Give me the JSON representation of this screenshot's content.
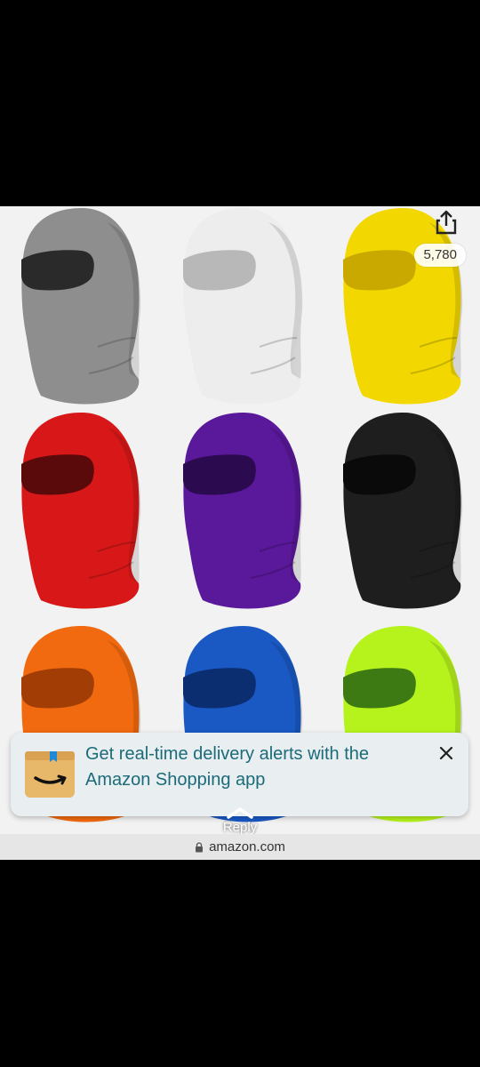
{
  "product_image": {
    "masks": [
      {
        "color_name": "gray",
        "fill": "#8e8e8e",
        "eye": "#2a2a2a"
      },
      {
        "color_name": "white",
        "fill": "#ededed",
        "eye": "#b8b8b8"
      },
      {
        "color_name": "yellow",
        "fill": "#f2d800",
        "eye": "#c9a800"
      },
      {
        "color_name": "red",
        "fill": "#d81818",
        "eye": "#5a0a0a"
      },
      {
        "color_name": "purple",
        "fill": "#5a189a",
        "eye": "#2c0a4f"
      },
      {
        "color_name": "black",
        "fill": "#1e1e1e",
        "eye": "#0a0a0a"
      },
      {
        "color_name": "orange",
        "fill": "#f26a0f",
        "eye": "#a33d06"
      },
      {
        "color_name": "blue",
        "fill": "#1a59c4",
        "eye": "#0b2e70"
      },
      {
        "color_name": "lime",
        "fill": "#b6f21c",
        "eye": "#3e7a14"
      }
    ]
  },
  "overlay": {
    "share_icon": "share-icon",
    "count": "5,780"
  },
  "banner": {
    "icon": "amazon-app-icon",
    "text": "Get real-time delivery alerts with the Amazon Shopping app",
    "close_icon": "close-icon"
  },
  "reply": {
    "label": "Reply",
    "icon": "chevron-up-icon"
  },
  "urlbar": {
    "domain": "amazon.com",
    "icon": "lock-icon"
  },
  "colors": {
    "banner_text": "#1b6b7a",
    "banner_bg": "#e9eef0"
  }
}
